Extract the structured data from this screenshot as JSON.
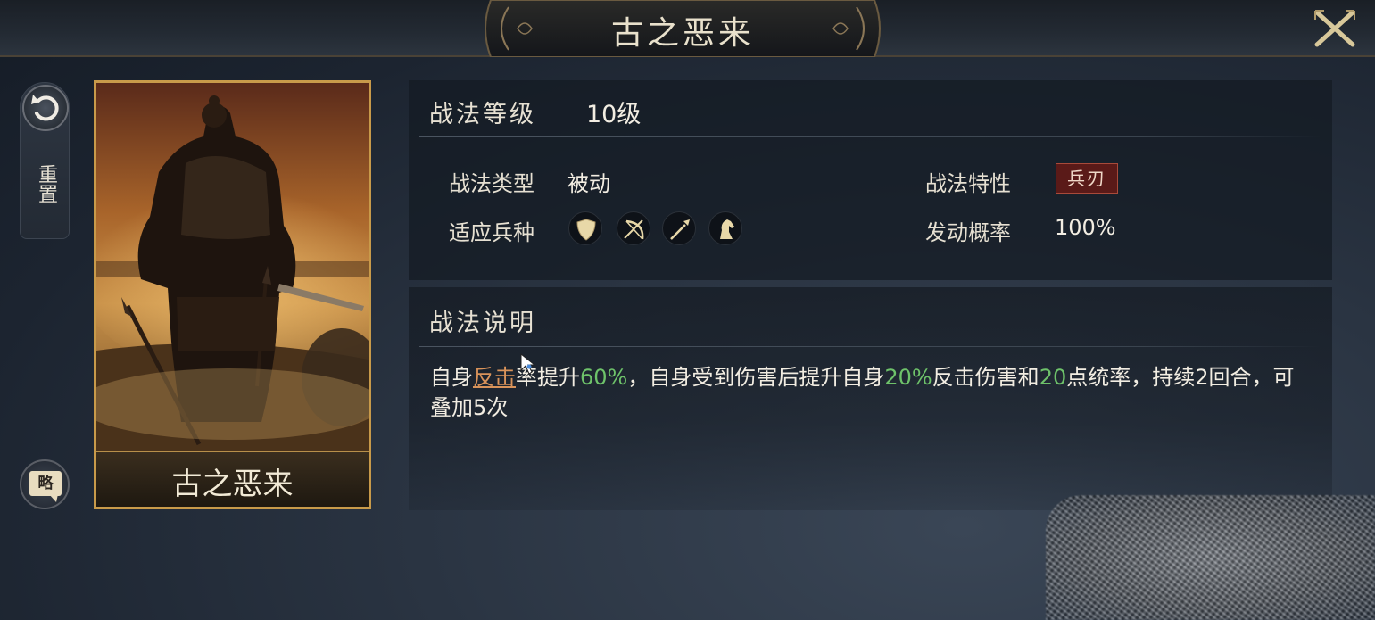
{
  "header": {
    "title": "古之恶来",
    "close_icon": "close-x-icon"
  },
  "sidebar": {
    "reset_label": "重置",
    "reset_icon": "undo-arrow-icon",
    "brief_label": "略"
  },
  "card": {
    "name": "古之恶来",
    "art": "warrior-portrait"
  },
  "tactic": {
    "level_label": "战法等级",
    "level_value": "10级",
    "type_label": "战法类型",
    "type_value": "被动",
    "trait_label": "战法特性",
    "trait_value": "兵刃",
    "troops_label": "适应兵种",
    "troop_icons": [
      "shield-icon",
      "bow-icon",
      "spear-icon",
      "horse-icon"
    ],
    "chance_label": "发动概率",
    "chance_value": "100%"
  },
  "description": {
    "title": "战法说明",
    "parts": [
      {
        "text": "自身",
        "style": "normal"
      },
      {
        "text": "反击",
        "style": "keyword"
      },
      {
        "text": "率提升",
        "style": "normal"
      },
      {
        "text": "60%",
        "style": "highlight"
      },
      {
        "text": "，自身受到伤害后提升自身",
        "style": "normal"
      },
      {
        "text": "20%",
        "style": "highlight"
      },
      {
        "text": "反击伤害和",
        "style": "normal"
      },
      {
        "text": "20",
        "style": "highlight"
      },
      {
        "text": "点统率，持续2回合，可叠加5次",
        "style": "normal"
      }
    ]
  },
  "colors": {
    "highlight": "#6ec26a",
    "keyword": "#d9935a",
    "card_border": "#c89a4a",
    "trait_bg": "#5a1a18"
  }
}
